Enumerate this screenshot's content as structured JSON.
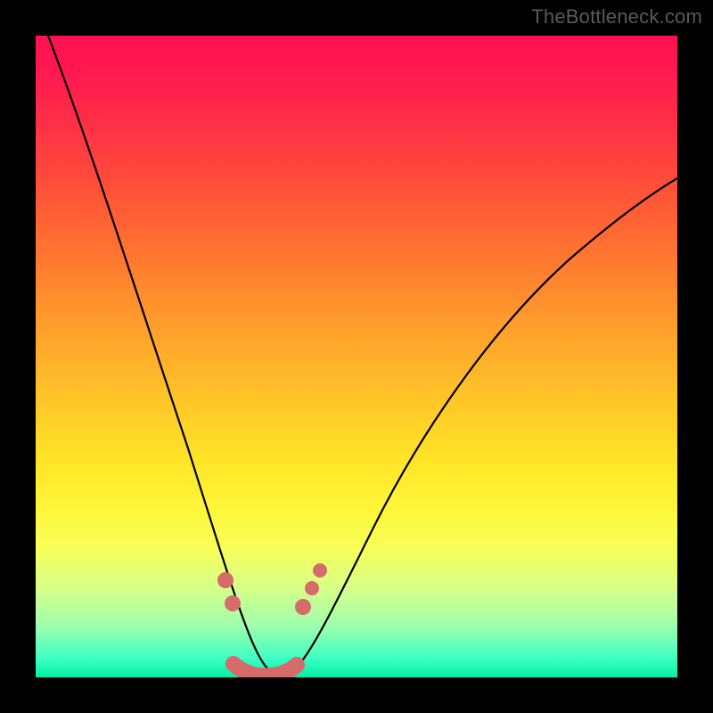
{
  "watermark": "TheBottleneck.com",
  "chart_data": {
    "type": "line",
    "title": "",
    "xlabel": "",
    "ylabel": "",
    "xlim": [
      0,
      100
    ],
    "ylim": [
      0,
      100
    ],
    "grid": false,
    "legend": false,
    "background_gradient": {
      "direction": "vertical",
      "stops": [
        {
          "pos": 0,
          "color": "#ff1151"
        },
        {
          "pos": 14,
          "color": "#ff3046"
        },
        {
          "pos": 34,
          "color": "#ff7530"
        },
        {
          "pos": 56,
          "color": "#ffc328"
        },
        {
          "pos": 74,
          "color": "#fff73a"
        },
        {
          "pos": 86,
          "color": "#d8ff88"
        },
        {
          "pos": 100,
          "color": "#00f0a8"
        }
      ]
    },
    "series": [
      {
        "name": "bottleneck-curve",
        "color": "#000000",
        "x": [
          2,
          6,
          10,
          14,
          18,
          22,
          26,
          28,
          30,
          32,
          34,
          36,
          38,
          40,
          42,
          46,
          50,
          56,
          62,
          70,
          78,
          86,
          94,
          100
        ],
        "y": [
          100,
          88,
          76,
          65,
          54,
          43,
          32,
          26,
          20,
          14,
          8,
          4,
          1,
          0,
          1,
          5,
          12,
          22,
          32,
          43,
          53,
          61,
          68,
          73
        ]
      }
    ],
    "markers": [
      {
        "name": "worm-segment",
        "shape": "capsule",
        "color": "#d66b6b",
        "x_range": [
          30.5,
          40.5
        ],
        "y": 0.5
      },
      {
        "name": "bead",
        "shape": "circle",
        "color": "#d66b6b",
        "x": 29.5,
        "y": 15
      },
      {
        "name": "bead",
        "shape": "circle",
        "color": "#d66b6b",
        "x": 30.8,
        "y": 11
      },
      {
        "name": "bead",
        "shape": "circle",
        "color": "#d66b6b",
        "x": 41.5,
        "y": 11
      },
      {
        "name": "bead",
        "shape": "circle",
        "color": "#d66b6b",
        "x": 43.0,
        "y": 14
      },
      {
        "name": "bead",
        "shape": "circle",
        "color": "#d66b6b",
        "x": 44.2,
        "y": 17
      }
    ]
  }
}
